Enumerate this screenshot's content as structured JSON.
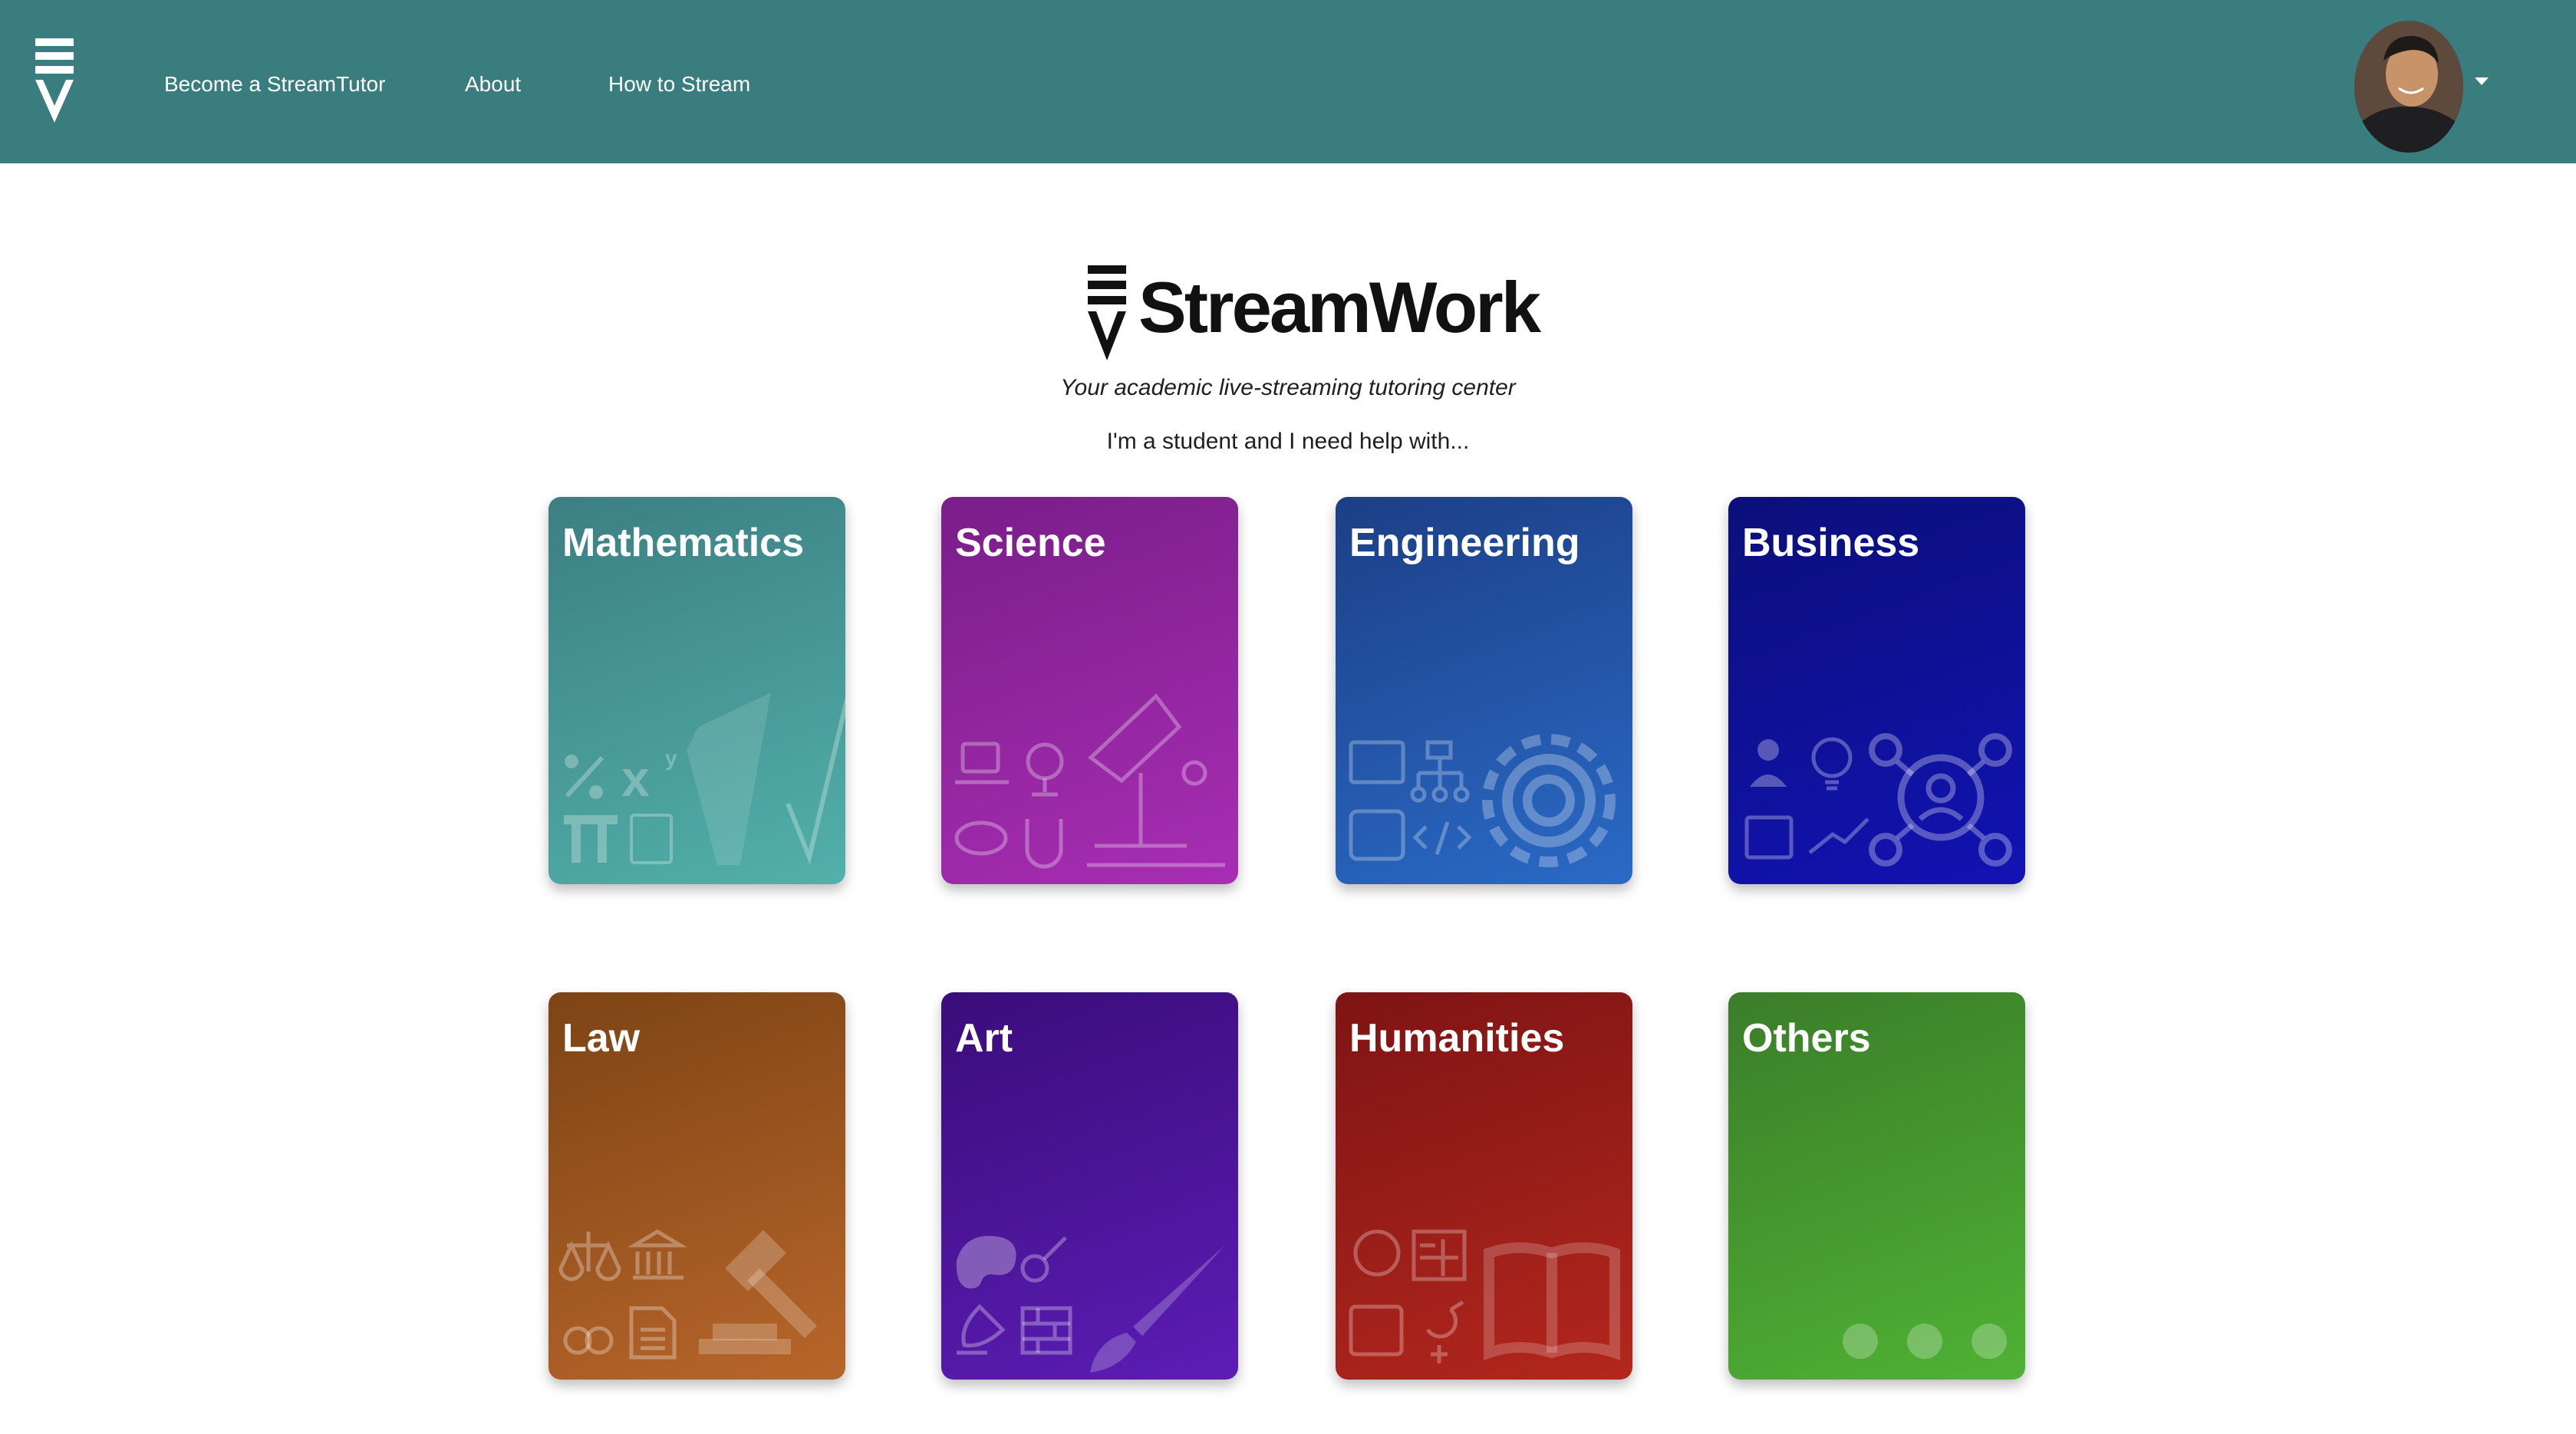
{
  "header": {
    "nav": [
      {
        "label": "Become a StreamTutor"
      },
      {
        "label": "About"
      },
      {
        "label": "How to Stream"
      }
    ],
    "background_color": "#3a7d7e"
  },
  "hero": {
    "title": "StreamWork",
    "tagline": "Your academic live-streaming tutoring center",
    "prompt": "I'm a student and I need help with..."
  },
  "categories": [
    {
      "label": "Mathematics",
      "icon": "math-icons",
      "color": "#52b0aa"
    },
    {
      "label": "Science",
      "icon": "microscope-icon",
      "color": "#a82eb3"
    },
    {
      "label": "Engineering",
      "icon": "gear-icon",
      "color": "#2a6ac6"
    },
    {
      "label": "Business",
      "icon": "network-icon",
      "color": "#1213b3"
    },
    {
      "label": "Law",
      "icon": "gavel-icon",
      "color": "#b8662a"
    },
    {
      "label": "Art",
      "icon": "paintbrush-icon",
      "color": "#5c1db5"
    },
    {
      "label": "Humanities",
      "icon": "book-icon",
      "color": "#b3271d"
    },
    {
      "label": "Others",
      "icon": "ellipsis-icon",
      "color": "#4fb234"
    }
  ]
}
